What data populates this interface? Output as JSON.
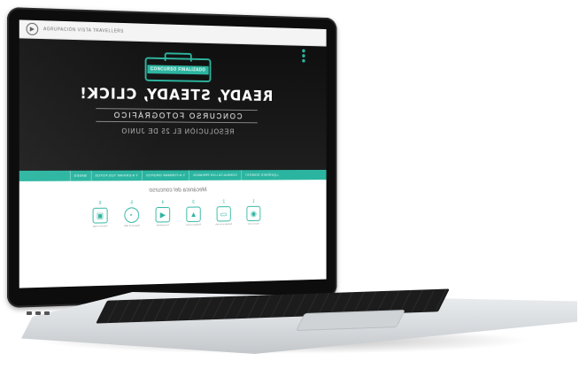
{
  "header": {
    "org_text": "AGRUPACIÓN VISTA TRAVELLERS",
    "logo_glyph": "▶"
  },
  "hero": {
    "badge": "CONCURSO FINALIZADO",
    "headline": "READY, STEADY, CLICK!",
    "subheadline": "CONCURSO FOTOGRÁFICO",
    "resolution": "RESOLUCIÓN EL 25 DE JUNIO"
  },
  "nav": {
    "items": [
      "¿QUIÉNES SOMOS?",
      "CONSULTA LOS PREMIOS",
      "Y A FORMAR GRUPOS",
      "Y A ENVIAR TUS FOTOS",
      "BASES"
    ]
  },
  "mechanics": {
    "title": "Mecánica del concurso",
    "steps": [
      {
        "num": "1",
        "icon": "camera-icon",
        "glyph": "◉",
        "text": "Haz tu foto"
      },
      {
        "num": "2",
        "icon": "monitor-icon",
        "glyph": "▭",
        "text": "Súbela a la web"
      },
      {
        "num": "3",
        "icon": "image-icon",
        "glyph": "▲",
        "text": "Publica tu foto"
      },
      {
        "num": "4",
        "icon": "megaphone-icon",
        "glyph": "◀",
        "text": "Compártela"
      },
      {
        "num": "5",
        "icon": "clock-icon",
        "glyph": "◔",
        "text": "Espera el fallo"
      },
      {
        "num": "6",
        "icon": "suitcase-icon",
        "glyph": "▣",
        "text": "Gana tu viaje"
      }
    ]
  },
  "colors": {
    "accent": "#2bb5a0",
    "hero_bg": "#141414"
  }
}
